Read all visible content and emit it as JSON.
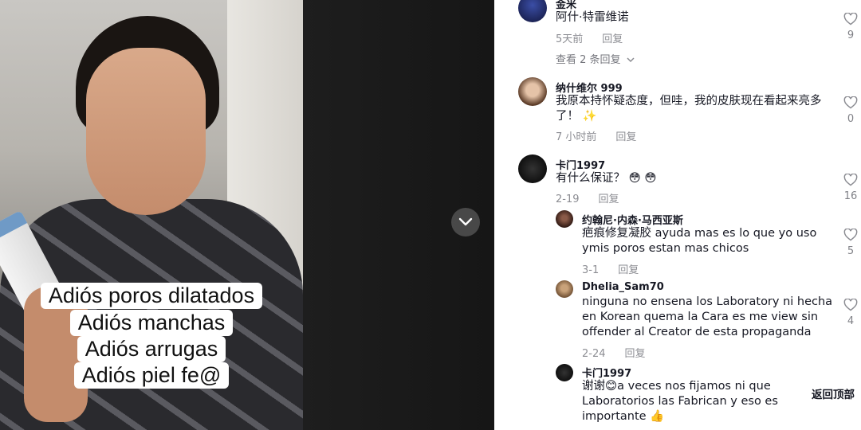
{
  "video": {
    "captions": [
      "Adiós poros dilatados",
      "Adiós manchas",
      "Adiós arrugas",
      "Adiós piel fe@"
    ]
  },
  "comments": [
    {
      "username": "金米",
      "text": "阿什·特雷维诺",
      "time": "5天前",
      "reply_label": "回复",
      "likes": "9",
      "view_replies": "查看 2 条回复"
    },
    {
      "username": "纳什维尔 999",
      "text": "我原本持怀疑态度，但哇，我的皮肤现在看起来亮多了！ ✨",
      "time": "7 小时前",
      "reply_label": "回复",
      "likes": "0"
    },
    {
      "username": "卡门1997",
      "text": "有什么保证？ 😳 😳",
      "time": "2-19",
      "reply_label": "回复",
      "likes": "16",
      "replies": [
        {
          "username": "约翰尼·内森·马西亚斯",
          "text": "疤痕修复凝胶 ayuda mas es lo que yo uso ymis poros estan mas chicos",
          "time": "3-1",
          "reply_label": "回复",
          "likes": "5"
        },
        {
          "username": "Dhelia_Sam70",
          "text": "ninguna no ensena los Laboratory ni hecha en Korean quema la Cara es me view sin offender al Creator de esta propaganda",
          "time": "2-24",
          "reply_label": "回复",
          "likes": "4"
        },
        {
          "username": "卡门1997",
          "text": "谢谢😊a veces nos fijamos ni que Laboratorios las Fabrican y eso es importante 👍"
        }
      ]
    }
  ],
  "back_to_top": "返回顶部",
  "colors": {
    "text": "#161823",
    "muted": "#8a8b91"
  }
}
